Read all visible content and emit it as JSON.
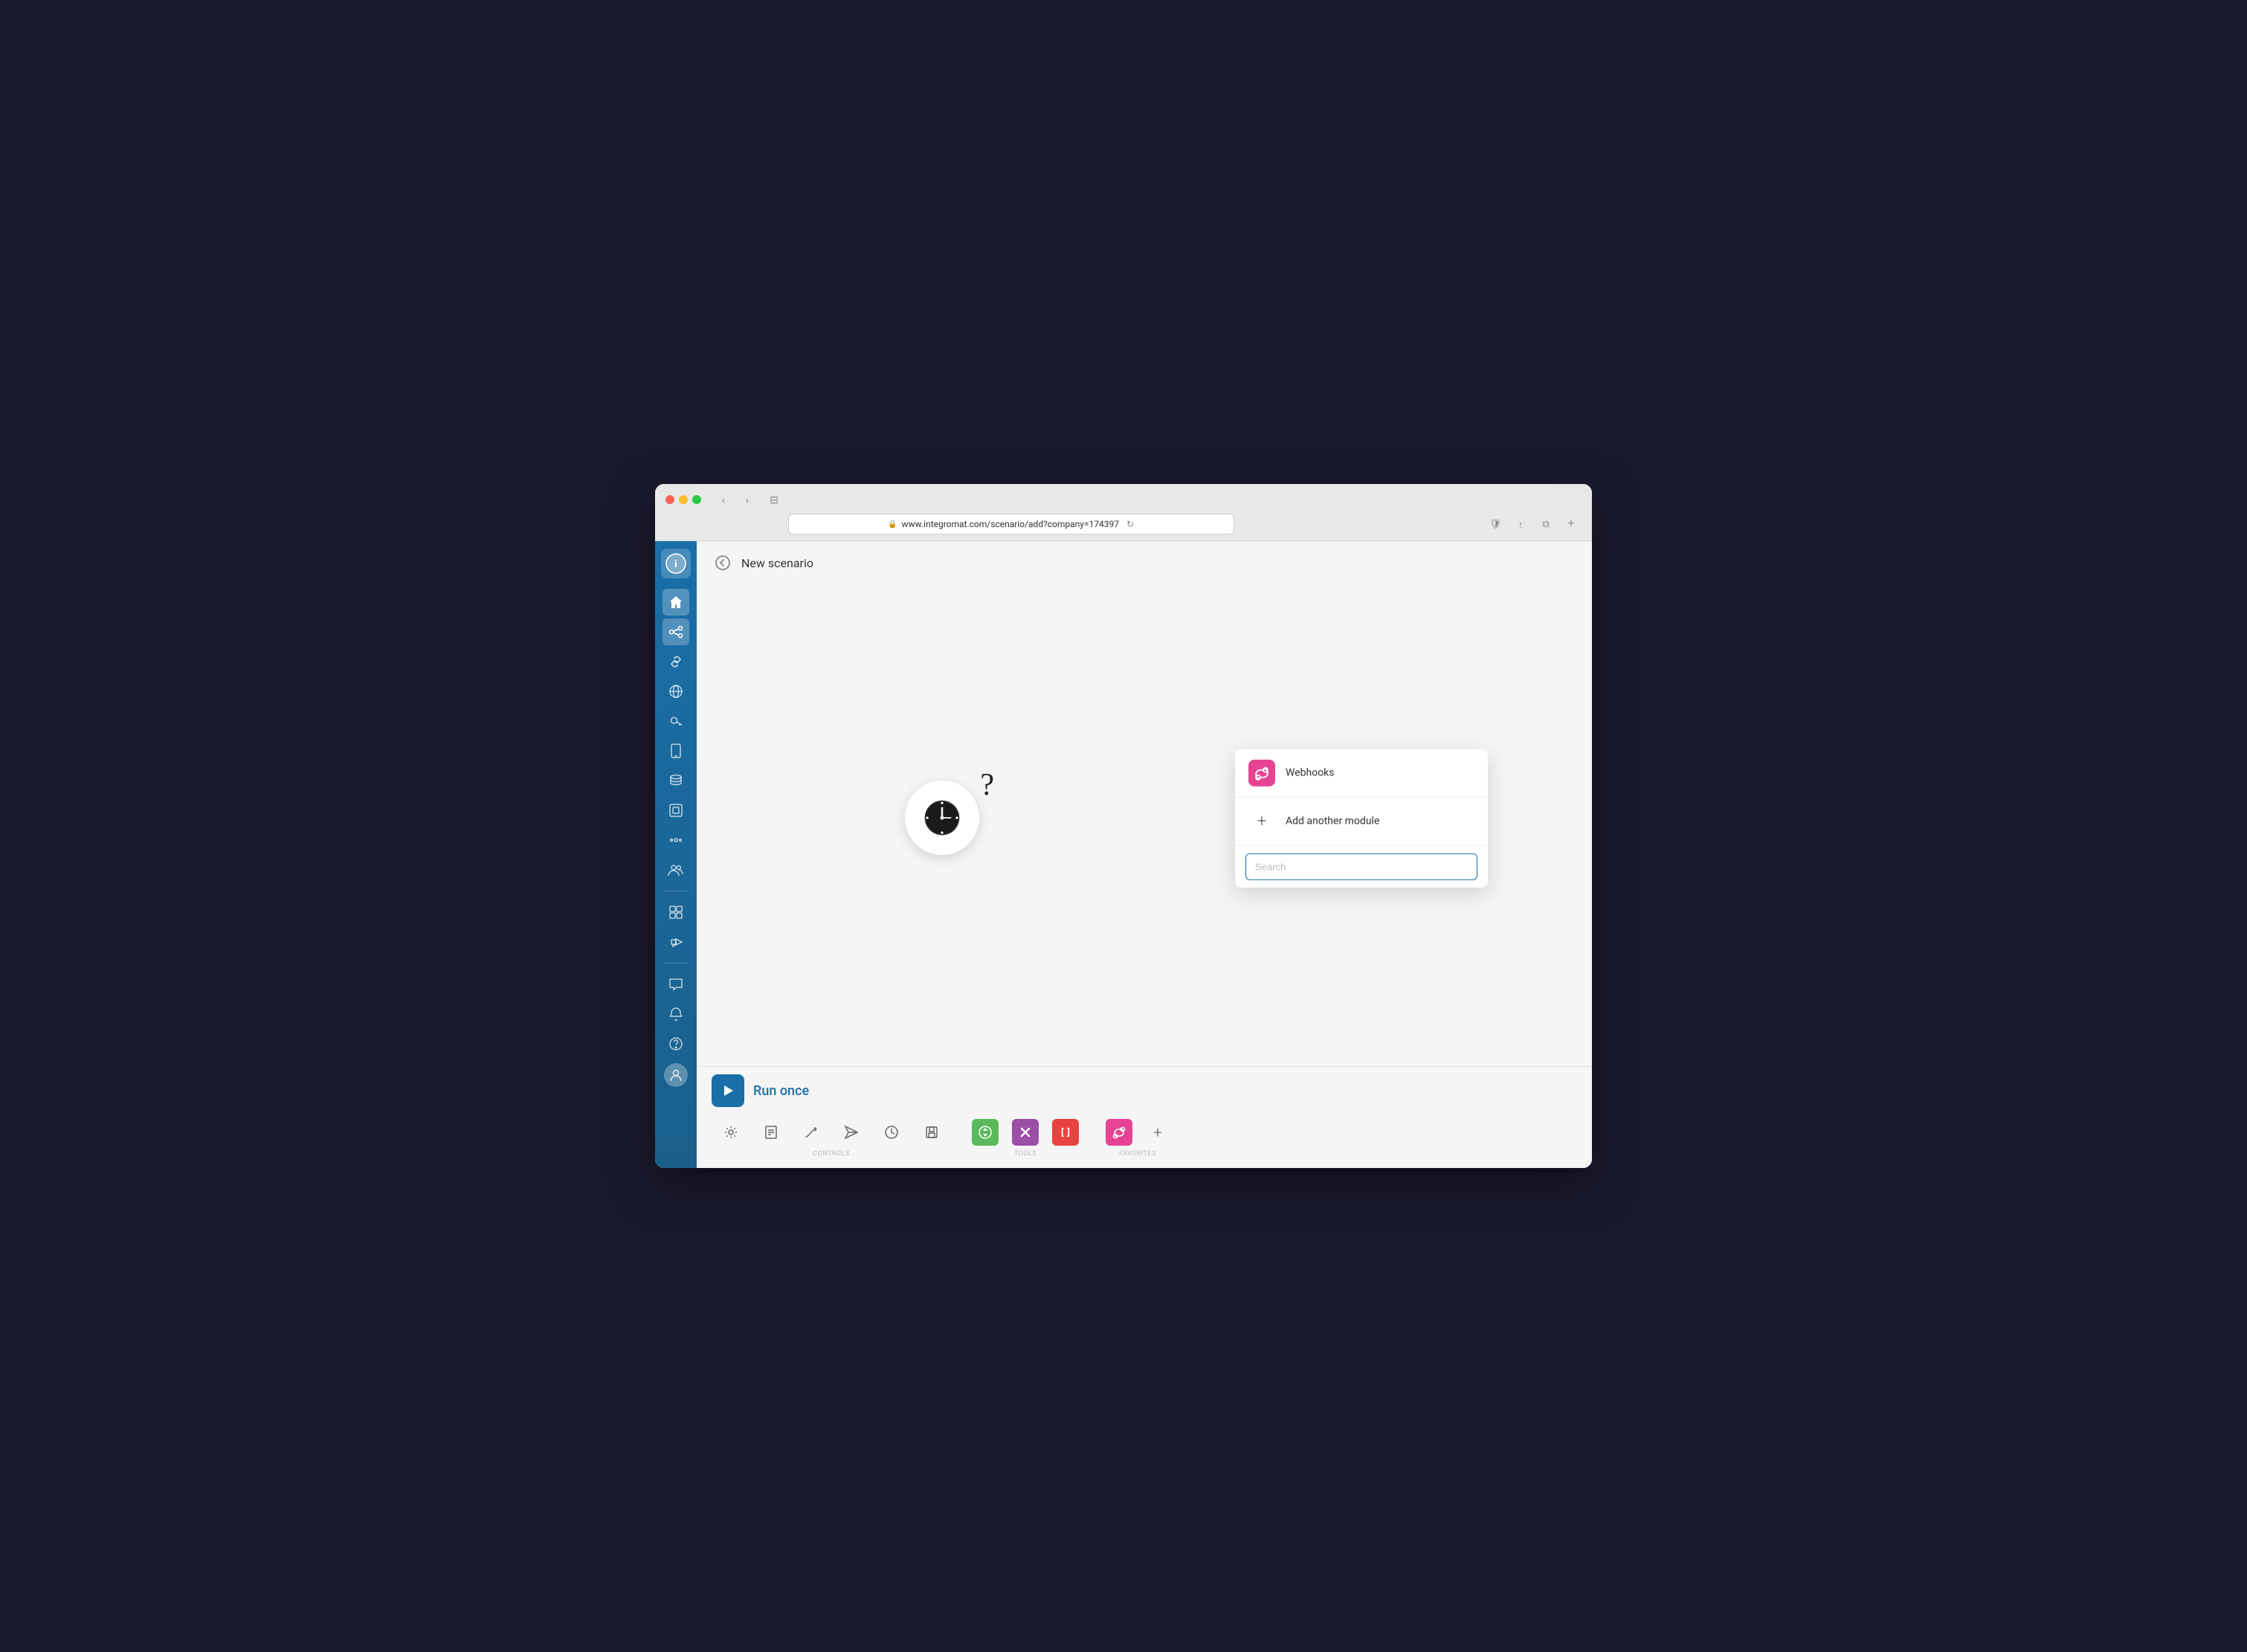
{
  "browser": {
    "url": "www.integromat.com/scenario/add?company=174397",
    "url_protocol": "🔒"
  },
  "header": {
    "back_label": "←",
    "title": "New scenario"
  },
  "sidebar": {
    "logo": "i",
    "nav_items": [
      {
        "id": "home",
        "icon": "⌂",
        "active": false
      },
      {
        "id": "scenarios",
        "icon": "⇄",
        "active": true
      },
      {
        "id": "connections",
        "icon": "🔗",
        "active": false
      },
      {
        "id": "webhooks",
        "icon": "🌐",
        "active": false
      },
      {
        "id": "keys",
        "icon": "🔑",
        "active": false
      },
      {
        "id": "devices",
        "icon": "📱",
        "active": false
      },
      {
        "id": "datastores",
        "icon": "🗄",
        "active": false
      },
      {
        "id": "datastructures",
        "icon": "◻",
        "active": false
      },
      {
        "id": "flow-control",
        "icon": "⊙",
        "active": false
      },
      {
        "id": "team",
        "icon": "👥",
        "active": false
      }
    ],
    "bottom_items": [
      {
        "id": "templates",
        "icon": "⊞"
      },
      {
        "id": "announcements",
        "icon": "📢"
      }
    ]
  },
  "module_menu": {
    "webhooks_label": "Webhooks",
    "add_another_label": "Add another module",
    "search_placeholder": "Search"
  },
  "toolbar": {
    "run_once_label": "Run once",
    "controls": [
      {
        "id": "settings",
        "icon": "⚙"
      },
      {
        "id": "notes",
        "icon": "☐"
      },
      {
        "id": "wand",
        "icon": "✦"
      },
      {
        "id": "send",
        "icon": "✈"
      },
      {
        "id": "schedule",
        "icon": "🕐"
      },
      {
        "id": "save",
        "icon": "💾"
      }
    ],
    "controls_label": "CONTROLS",
    "tools": [
      {
        "id": "flow",
        "icon": "⚙",
        "color": "green"
      },
      {
        "id": "router",
        "icon": "✕",
        "color": "purple"
      },
      {
        "id": "array",
        "icon": "[]",
        "color": "red"
      }
    ],
    "tools_label": "TOOLS",
    "favorites": [
      {
        "id": "webhooks-fav",
        "icon": "⚙",
        "color": "pink"
      }
    ],
    "favorites_label": "FAVORITES",
    "add_tool_label": "+"
  }
}
